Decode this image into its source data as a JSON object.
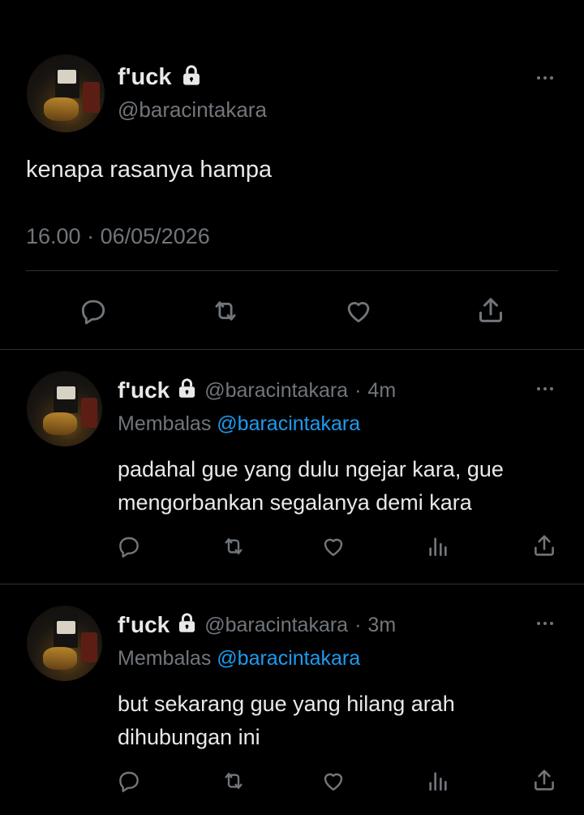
{
  "main_tweet": {
    "display_name": "f'uck",
    "handle": "@baracintakara",
    "text": "kenapa rasanya hampa",
    "time": "16.00",
    "dot": "·",
    "date": "06/05/2026"
  },
  "replies": [
    {
      "display_name": "f'uck",
      "handle": "@baracintakara",
      "dot": "·",
      "age": "4m",
      "replying_label": "Membalas",
      "replying_to": "@baracintakara",
      "text_line1": "padahal gue yang dulu ngejar kara, gue",
      "text_line2": "mengorbankan segalanya demi kara"
    },
    {
      "display_name": "f'uck",
      "handle": "@baracintakara",
      "dot": "·",
      "age": "3m",
      "replying_label": "Membalas",
      "replying_to": "@baracintakara",
      "text_line1": "but sekarang gue yang hilang arah",
      "text_line2": "dihubungan ini"
    }
  ],
  "icons": {
    "reply": "reply-icon",
    "retweet": "retweet-icon",
    "like": "like-icon",
    "views": "views-icon",
    "share": "share-icon",
    "lock": "lock-icon",
    "more": "more-icon"
  },
  "colors": {
    "background": "#000000",
    "text": "#e7e9ea",
    "secondary": "#71767b",
    "accent": "#1d9bf0",
    "divider": "#2f3336"
  }
}
